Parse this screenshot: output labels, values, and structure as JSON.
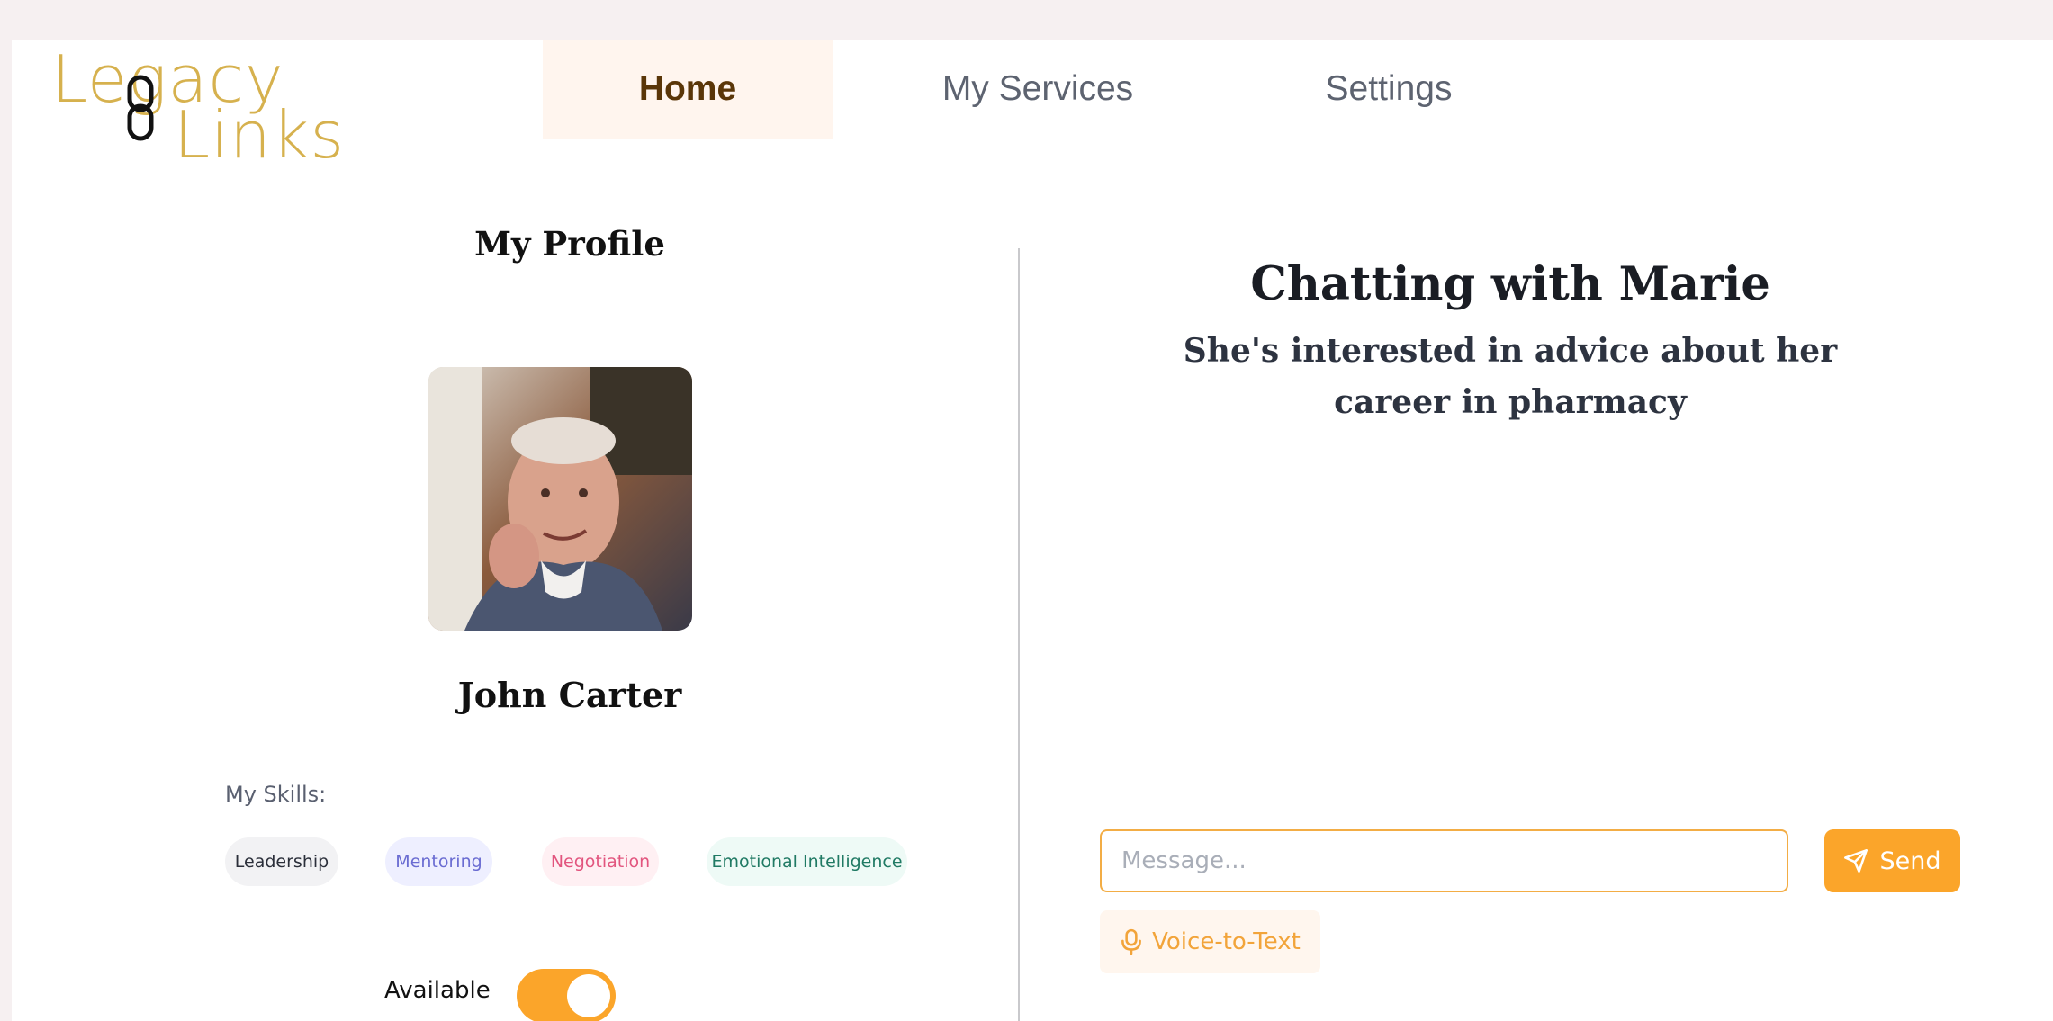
{
  "brand": {
    "line1": "Legacy",
    "line2": "Links",
    "color": "#d6b14e"
  },
  "nav": {
    "tabs": [
      {
        "label": "Home",
        "active": true
      },
      {
        "label": "My Services",
        "active": false
      },
      {
        "label": "Settings",
        "active": false
      }
    ]
  },
  "profile": {
    "title": "My Profile",
    "name": "John Carter",
    "skills_label": "My Skills:",
    "skills": [
      "Leadership",
      "Mentoring",
      "Negotiation",
      "Emotional Intelligence"
    ],
    "available_label": "Available",
    "available": true
  },
  "chat": {
    "title": "Chatting with Marie",
    "subtitle": "She's interested in advice about her career in pharmacy",
    "message_placeholder": "Message...",
    "message_value": "",
    "send_label": "Send",
    "voice_label": "Voice-to-Text"
  },
  "colors": {
    "accent": "#fba52a",
    "active_tab_bg": "#fff5ee",
    "active_tab_text": "#5a3608"
  },
  "icons": {
    "send": "paper-plane-icon",
    "voice": "microphone-icon",
    "brand": "link-icon"
  }
}
